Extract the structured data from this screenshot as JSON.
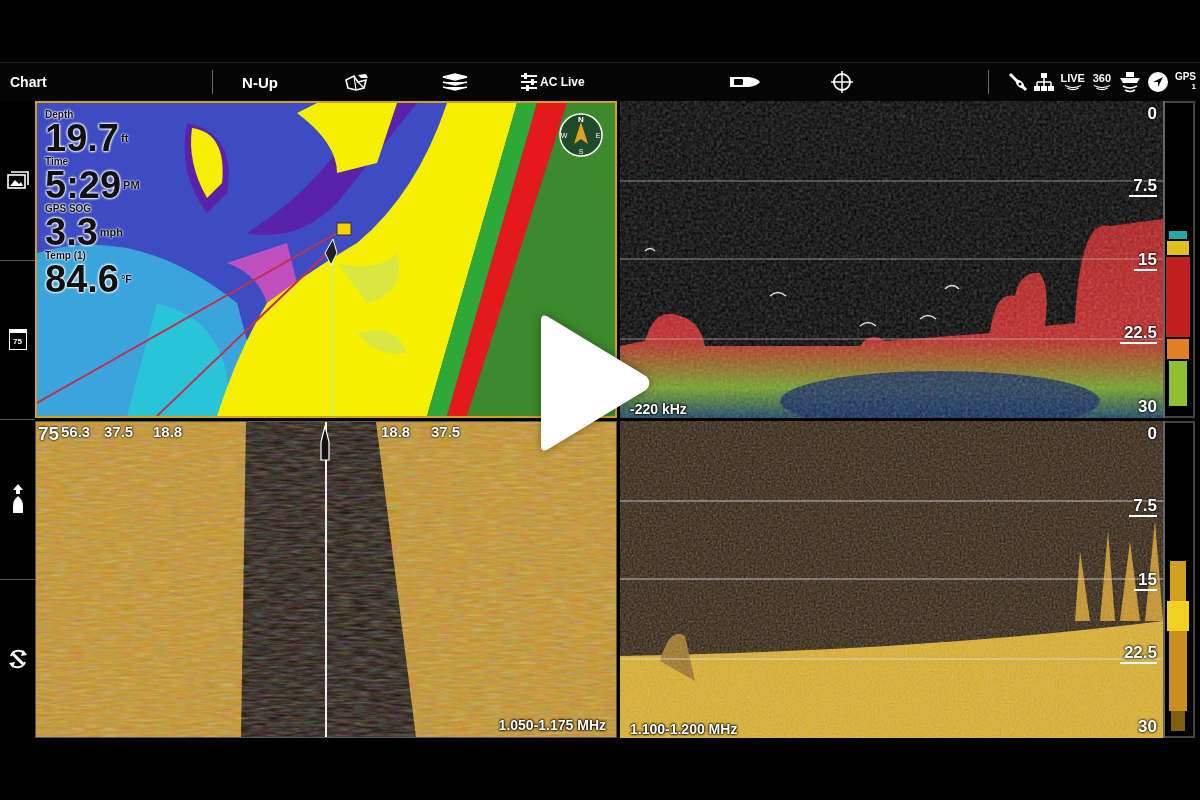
{
  "toolbar": {
    "title": "Chart",
    "orientation": "N-Up",
    "ac_live": "AC Live",
    "status_labels": [
      "LIVE",
      "360",
      "GPS"
    ],
    "gps_count": "1"
  },
  "sidebar": [
    {
      "kind": "picture"
    },
    {
      "kind": "gauge",
      "label": "75"
    },
    {
      "kind": "boat"
    },
    {
      "kind": "rotate"
    }
  ],
  "chart": {
    "readouts": [
      {
        "label": "Depth",
        "value": "19.7",
        "unit": "ft"
      },
      {
        "label": "Time",
        "value": "5:29",
        "unit": "PM"
      },
      {
        "label": "GPS SOG",
        "value": "3.3",
        "unit": "mph"
      },
      {
        "label": "Temp (1)",
        "value": "84.6",
        "unit": "°F"
      }
    ],
    "compass": [
      "N",
      "E",
      "S",
      "W"
    ]
  },
  "sonar_2d": {
    "depth_scale": [
      "0",
      "7.5",
      "15",
      "22.5",
      "30"
    ],
    "frequency": "-220 kHz"
  },
  "side_imaging": {
    "range_labels": [
      "75",
      "56.3",
      "37.5",
      "18.8",
      "18.8",
      "37.5"
    ],
    "frequency": "1.050-1.175 MHz"
  },
  "down_imaging": {
    "depth_scale": [
      "0",
      "7.5",
      "15",
      "22.5",
      "30"
    ],
    "frequency": "1.100-1.200 MHz"
  }
}
